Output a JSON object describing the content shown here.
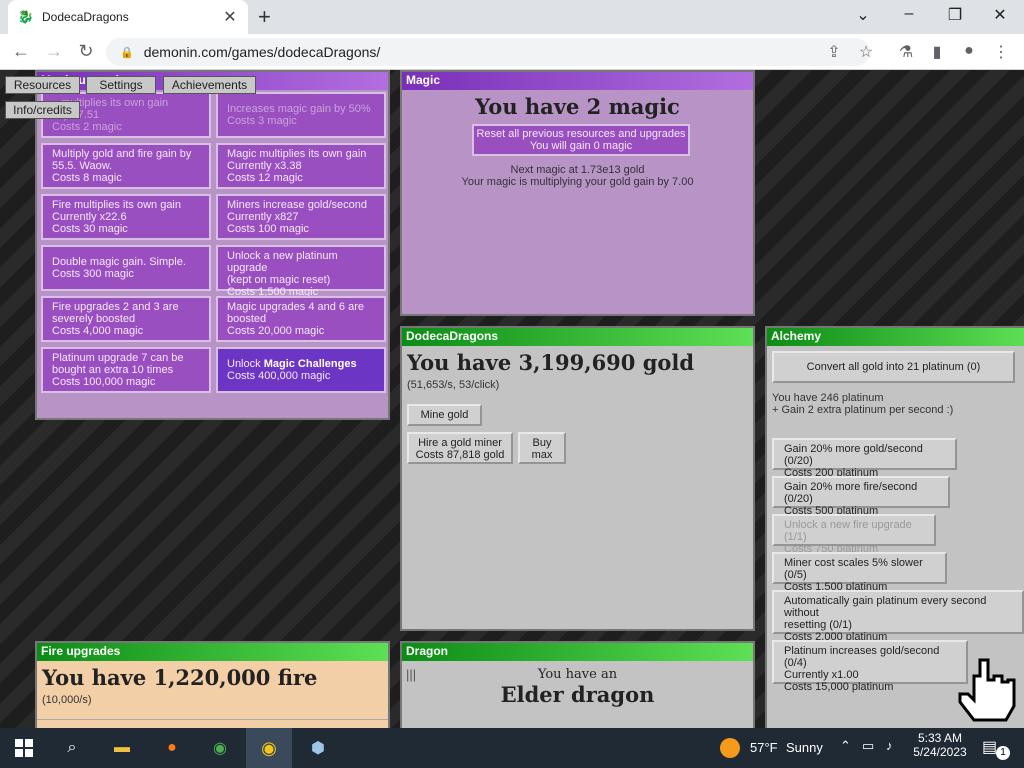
{
  "browser": {
    "tab_title": "DodecaDragons",
    "url": "demonin.com/games/dodecaDragons/"
  },
  "nav": {
    "resources": "Resources",
    "settings": "Settings",
    "achievements": "Achievements",
    "info_credits": "Info/credits"
  },
  "magic_upgrades": {
    "header": "Magic upgrades",
    "items": [
      {
        "lines": [
          "...multiplies its own gain",
          "...ly x7.51",
          "Costs 2 magic"
        ]
      },
      {
        "lines": [
          "Increases magic gain by 50%",
          "Costs 3 magic"
        ]
      },
      {
        "lines": [
          "Multiply gold and fire gain by",
          "55.5. Waow.",
          "Costs 8 magic"
        ]
      },
      {
        "lines": [
          "Magic multiplies its own gain",
          "Currently x3.38",
          "Costs 12 magic"
        ]
      },
      {
        "lines": [
          "Fire multiplies its own gain",
          "Currently x22.6",
          "Costs 30 magic"
        ]
      },
      {
        "lines": [
          "Miners increase gold/second",
          "Currently x827",
          "Costs 100 magic"
        ]
      },
      {
        "lines": [
          "Double magic gain. Simple.",
          "Costs 300 magic"
        ]
      },
      {
        "lines": [
          "Unlock a new platinum upgrade",
          "(kept on magic reset)",
          "Costs 1,500 magic"
        ]
      },
      {
        "lines": [
          "Fire upgrades 2 and 3 are",
          "severely boosted",
          "Costs 4,000 magic"
        ]
      },
      {
        "lines": [
          "Magic upgrades 4 and 6 are",
          "boosted",
          "Costs 20,000 magic"
        ]
      },
      {
        "lines": [
          "Platinum upgrade 7 can be",
          "bought an extra 10 times",
          "Costs 100,000 magic"
        ]
      },
      {
        "prefix": "Unlock ",
        "bold": "Magic Challenges",
        "cost": "Costs 400,000 magic"
      }
    ]
  },
  "magic": {
    "header": "Magic",
    "title": "You have 2 magic",
    "reset_line1": "Reset all previous resources and upgrades",
    "reset_line2": "You will gain 0 magic",
    "next": "Next magic at 1.73e13 gold",
    "multiplier": "Your magic is multiplying your gold gain by 7.00"
  },
  "dodeca": {
    "header": "DodecaDragons",
    "title": "You have 3,199,690 gold",
    "rate": "(51,653/s, 53/click)",
    "mine": "Mine gold",
    "hire_line1": "Hire a gold miner",
    "hire_line2": "Costs 87,818 gold",
    "buy_line1": "Buy",
    "buy_line2": "max"
  },
  "alchemy": {
    "header": "Alchemy",
    "convert": "Convert all gold into 21 platinum (0)",
    "have": "You have 246 platinum",
    "gain": "+ Gain 2 extra platinum per second :)",
    "upgrades": [
      {
        "lines": [
          "Gain 20% more gold/second (0/20)",
          "Costs 200 platinum"
        ]
      },
      {
        "lines": [
          "Gain 20% more fire/second (0/20)",
          "Costs 500 platinum"
        ]
      },
      {
        "lines": [
          "Unlock a new fire upgrade (1/1)",
          "Costs 750 platinum"
        ]
      },
      {
        "lines": [
          "Miner cost scales 5% slower (0/5)",
          "Costs 1,500 platinum"
        ]
      },
      {
        "lines": [
          "Automatically gain platinum every second without",
          "resetting (0/1)",
          "Costs 2,000 platinum"
        ]
      },
      {
        "lines": [
          "Platinum increases gold/second (0/4)",
          "Currently x1.00",
          "Costs 15,000 platinum"
        ]
      }
    ]
  },
  "fire": {
    "header": "Fire upgrades",
    "title": "You have 1,220,000 fire",
    "rate": "(10,000/s)"
  },
  "dragon": {
    "header": "Dragon",
    "line1": "You have an",
    "line2": "Elder dragon"
  },
  "taskbar": {
    "temp": "57°F",
    "weather": "Sunny",
    "time": "5:33 AM",
    "date": "5/24/2023",
    "notif_count": "1"
  }
}
